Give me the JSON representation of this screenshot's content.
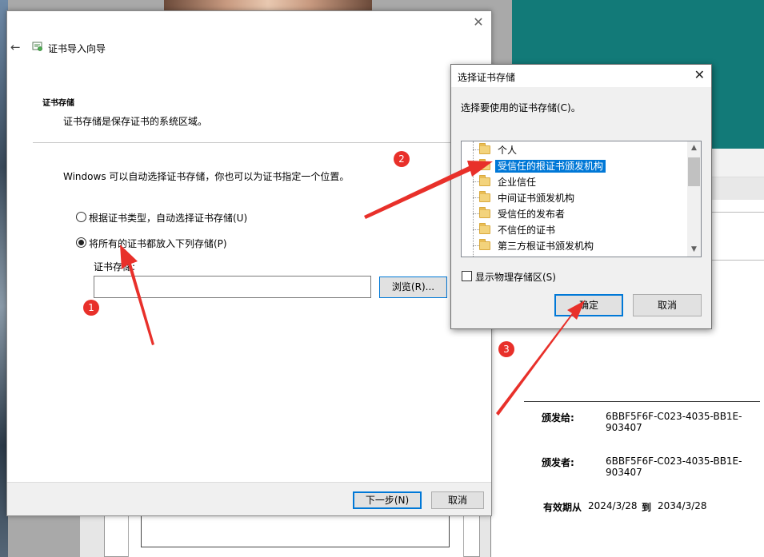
{
  "wizard": {
    "title": "证书导入向导",
    "section_title": "证书存储",
    "section_desc": "证书存储是保存证书的系统区域。",
    "intro": "Windows 可以自动选择证书存储，你也可以为证书指定一个位置。",
    "radio_auto": "根据证书类型，自动选择证书存储(U)",
    "radio_manual": "将所有的证书都放入下列存储(P)",
    "store_label": "证书存储:",
    "store_value": "",
    "browse": "浏览(R)...",
    "next": "下一步(N)",
    "cancel": "取消",
    "selected_option": "manual"
  },
  "dialog": {
    "title": "选择证书存储",
    "prompt": "选择要使用的证书存储(C)。",
    "stores": [
      "个人",
      "受信任的根证书颁发机构",
      "企业信任",
      "中间证书颁发机构",
      "受信任的发布者",
      "不信任的证书",
      "第三方根证书颁发机构"
    ],
    "selected_store": "受信任的根证书颁发机构",
    "show_physical": "显示物理存储区(S)",
    "show_physical_checked": false,
    "ok": "确定",
    "cancel": "取消"
  },
  "certificate": {
    "issued_to_label": "颁发给:",
    "issued_to": "6BBF5F6F-C023-4035-BB1E-903407",
    "issued_by_label": "颁发者:",
    "issued_by": "6BBF5F6F-C023-4035-BB1E-903407",
    "valid_from_label": "有效期从",
    "valid_from": "2024/3/28",
    "to_label": "到",
    "valid_to": "2034/3/28"
  },
  "annotations": {
    "step1": "1",
    "step2": "2",
    "step3": "3",
    "arrow_color": "#e8302a"
  },
  "icons": {
    "back": "back-arrow-icon",
    "certificate": "certificate-icon",
    "close": "close-icon",
    "folder": "folder-icon"
  }
}
